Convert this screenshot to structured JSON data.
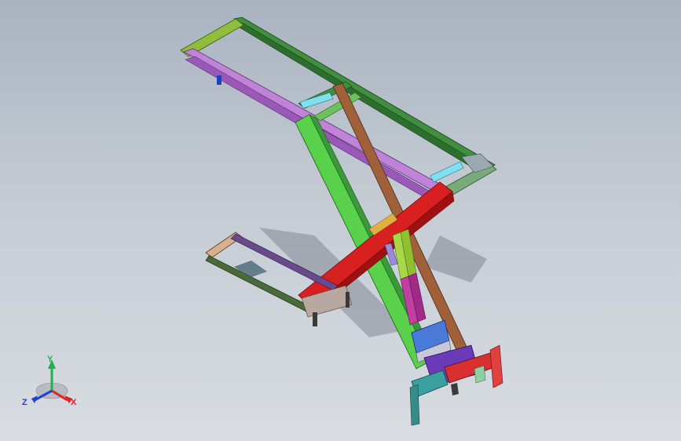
{
  "viewport": {
    "background_top": "#a9b3c0",
    "background_bottom": "#d9dde2"
  },
  "triad": {
    "y_label": "Y",
    "x_label": "X",
    "z_label": "Z",
    "y_color": "#22b14c",
    "x_color": "#e02020",
    "z_color": "#1f3fd8"
  },
  "model": {
    "description_icon": "scissor-lift-assembly-icon",
    "part_colors": {
      "top_frame_side": "#3f8f3f",
      "top_frame_purple": "#b070c8",
      "end_bar": "#8fbf3a",
      "green_arm": "#5ad14a",
      "brown_arm": "#a0603a",
      "red_arm": "#d82020",
      "cyan_link": "#80e0f0",
      "base_frame": "#4a6a3a",
      "cylinder_green": "#a8d848",
      "cylinder_magenta": "#c040a0",
      "blue_block": "#4a7ad8",
      "teal_bracket": "#3aa0a0"
    }
  }
}
